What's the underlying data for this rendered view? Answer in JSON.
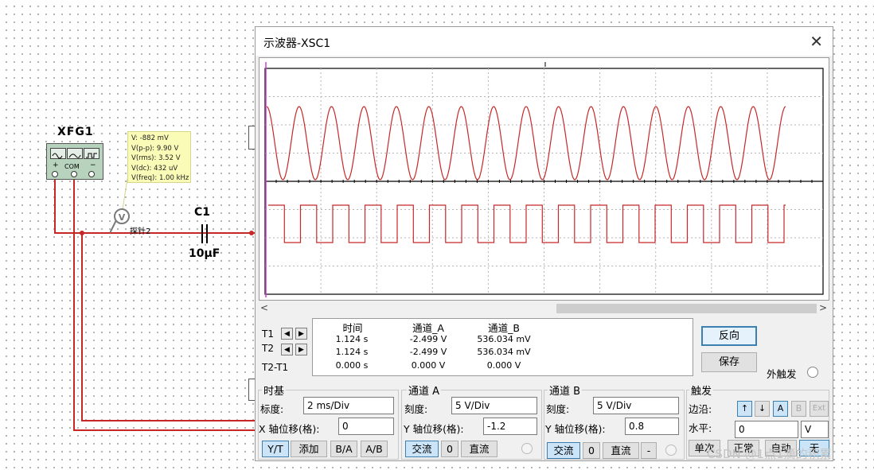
{
  "colors": {
    "wire": "#c62828",
    "trace_a": "#c62828",
    "trace_b": "#c62828",
    "accent": "#3c7fb1"
  },
  "schematic": {
    "function_generator": {
      "label": "XFG1",
      "com_label": "COM",
      "plus": "+",
      "minus": "−"
    },
    "probe": {
      "label": "探针2",
      "icon": "V",
      "readings": [
        "V: -882 mV",
        "V(p-p): 9.90 V",
        "V(rms): 3.52 V",
        "V(dc): 432 uV",
        "V(freq): 1.00 kHz"
      ]
    },
    "capacitor": {
      "name": "C1",
      "value": "10µF"
    }
  },
  "oscilloscope": {
    "title": "示波器-XSC1",
    "close_icon": "close-icon",
    "traces": [
      {
        "name": "A",
        "shape": "sine",
        "color": "#c62828",
        "cycles": 16,
        "frequency": "1.00 kHz"
      },
      {
        "name": "B",
        "shape": "square",
        "color": "#c62828",
        "cycles": 16
      }
    ],
    "cursors": {
      "t1_label": "T1",
      "t2_label": "T2",
      "t2t1_label": "T2-T1",
      "header": {
        "time": "时间",
        "channel_a": "通道_A",
        "channel_b": "通道_B"
      },
      "rows": [
        {
          "time": "1.124 s",
          "a": "-2.499 V",
          "b": "536.034 mV"
        },
        {
          "time": "1.124 s",
          "a": "-2.499 V",
          "b": "536.034 mV"
        },
        {
          "time": "0.000 s",
          "a": "0.000 V",
          "b": "0.000 V"
        }
      ]
    },
    "buttons": {
      "invert": "反向",
      "save": "保存",
      "external_trigger": "外触发"
    },
    "timebase": {
      "title": "时基",
      "scale_label": "标度:",
      "scale_value": "2 ms/Div",
      "xpos_label": "X 轴位移(格):",
      "xpos_value": "0",
      "modes": [
        "Y/T",
        "添加",
        "B/A",
        "A/B"
      ],
      "active_mode": "Y/T"
    },
    "channel_a": {
      "title": "通道 A",
      "scale_label": "刻度:",
      "scale_value": "5  V/Div",
      "ypos_label": "Y 轴位移(格):",
      "ypos_value": "-1.2",
      "coupling": [
        "交流",
        "0",
        "直流"
      ],
      "active_coupling": "交流"
    },
    "channel_b": {
      "title": "通道 B",
      "scale_label": "刻度:",
      "scale_value": "5  V/Div",
      "ypos_label": "Y 轴位移(格):",
      "ypos_value": "0.8",
      "coupling": [
        "交流",
        "0",
        "直流",
        "-"
      ],
      "active_coupling": "交流"
    },
    "trigger": {
      "title": "触发",
      "edge_label": "边沿:",
      "level_label": "水平:",
      "level_value": "0",
      "level_unit": "V",
      "edge_buttons": [
        "↑",
        "↓"
      ],
      "source_buttons": [
        "A",
        "B",
        "Ext"
      ],
      "modes": [
        "单次",
        "正常",
        "自动",
        "无"
      ]
    }
  },
  "watermark": "CSDN @1点1滴的积累"
}
